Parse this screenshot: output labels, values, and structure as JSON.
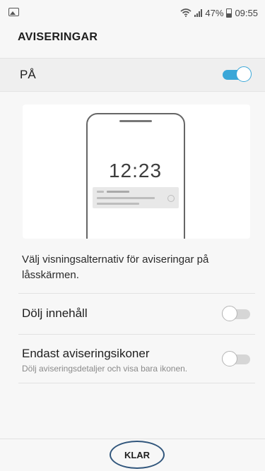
{
  "status_bar": {
    "gallery_icon": "gallery-icon",
    "wifi_icon": "wifi-icon",
    "signal_icon": "signal-icon",
    "battery_percent": "47%",
    "battery_icon": "battery-icon",
    "time": "09:55"
  },
  "header": {
    "title": "AVISERINGAR"
  },
  "master": {
    "label": "PÅ",
    "enabled": true,
    "accent": "#3aa7d8"
  },
  "preview": {
    "clock": "12:23"
  },
  "description": "Välj visningsalternativ för aviseringar på låsskärmen.",
  "settings": [
    {
      "label": "Dölj innehåll",
      "subtitle": "",
      "enabled": false
    },
    {
      "label": "Endast aviseringsikoner",
      "subtitle": "Dölj aviseringsdetaljer och visa bara ikonen.",
      "enabled": false
    }
  ],
  "footer": {
    "done_label": "KLAR",
    "highlight_color": "#31567c"
  }
}
